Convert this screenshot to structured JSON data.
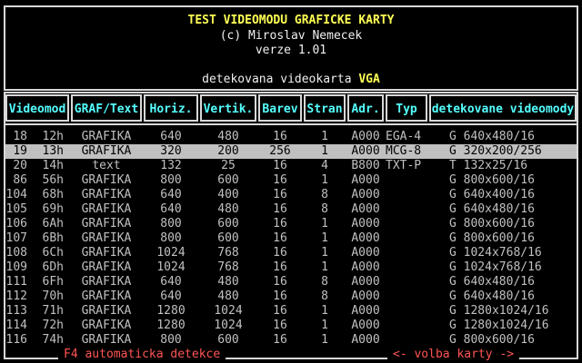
{
  "header": {
    "title": "TEST VIDEOMODU GRAFICKE KARTY",
    "author": "(c) Miroslav Nemecek",
    "version": "verze 1.01",
    "detected_label": "detekovana videokarta",
    "detected_card": "VGA"
  },
  "columns": [
    "Videomod",
    "GRAF/Text",
    "Horiz.",
    "Vertik.",
    "Barev",
    "Stran",
    "Adr.",
    "Typ",
    "detekovane videomody"
  ],
  "rows": [
    {
      "dec": "18",
      "hex": "12h",
      "mode": "GRAFIKA",
      "h": "640",
      "v": "480",
      "colors": "16",
      "pages": "1",
      "addr": "A000",
      "type": "EGA-4",
      "det": "G 640x480/16"
    },
    {
      "dec": "19",
      "hex": "13h",
      "mode": "GRAFIKA",
      "h": "320",
      "v": "200",
      "colors": "256",
      "pages": "1",
      "addr": "A000",
      "type": "MCG-8",
      "det": "G 320x200/256"
    },
    {
      "dec": "20",
      "hex": "14h",
      "mode": "text",
      "h": "132",
      "v": "25",
      "colors": "16",
      "pages": "4",
      "addr": "B800",
      "type": "TXT-P",
      "det": "T 132x25/16"
    },
    {
      "dec": "86",
      "hex": "56h",
      "mode": "GRAFIKA",
      "h": "800",
      "v": "600",
      "colors": "16",
      "pages": "1",
      "addr": "A000",
      "type": "",
      "det": "G 800x600/16"
    },
    {
      "dec": "104",
      "hex": "68h",
      "mode": "GRAFIKA",
      "h": "640",
      "v": "400",
      "colors": "16",
      "pages": "8",
      "addr": "A000",
      "type": "",
      "det": "G 640x400/16"
    },
    {
      "dec": "105",
      "hex": "69h",
      "mode": "GRAFIKA",
      "h": "640",
      "v": "480",
      "colors": "16",
      "pages": "8",
      "addr": "A000",
      "type": "",
      "det": "G 640x480/16"
    },
    {
      "dec": "106",
      "hex": "6Ah",
      "mode": "GRAFIKA",
      "h": "800",
      "v": "600",
      "colors": "16",
      "pages": "1",
      "addr": "A000",
      "type": "",
      "det": "G 800x600/16"
    },
    {
      "dec": "107",
      "hex": "6Bh",
      "mode": "GRAFIKA",
      "h": "800",
      "v": "600",
      "colors": "16",
      "pages": "1",
      "addr": "A000",
      "type": "",
      "det": "G 800x600/16"
    },
    {
      "dec": "108",
      "hex": "6Ch",
      "mode": "GRAFIKA",
      "h": "1024",
      "v": "768",
      "colors": "16",
      "pages": "1",
      "addr": "A000",
      "type": "",
      "det": "G 1024x768/16"
    },
    {
      "dec": "109",
      "hex": "6Dh",
      "mode": "GRAFIKA",
      "h": "1024",
      "v": "768",
      "colors": "16",
      "pages": "1",
      "addr": "A000",
      "type": "",
      "det": "G 1024x768/16"
    },
    {
      "dec": "111",
      "hex": "6Fh",
      "mode": "GRAFIKA",
      "h": "640",
      "v": "480",
      "colors": "16",
      "pages": "8",
      "addr": "A000",
      "type": "",
      "det": "G 640x480/16"
    },
    {
      "dec": "112",
      "hex": "70h",
      "mode": "GRAFIKA",
      "h": "640",
      "v": "480",
      "colors": "16",
      "pages": "8",
      "addr": "A000",
      "type": "",
      "det": "G 640x480/16"
    },
    {
      "dec": "113",
      "hex": "71h",
      "mode": "GRAFIKA",
      "h": "1280",
      "v": "1024",
      "colors": "16",
      "pages": "1",
      "addr": "A000",
      "type": "",
      "det": "G 1280x1024/16"
    },
    {
      "dec": "114",
      "hex": "72h",
      "mode": "GRAFIKA",
      "h": "1280",
      "v": "1024",
      "colors": "16",
      "pages": "1",
      "addr": "A000",
      "type": "",
      "det": "G 1280x1024/16"
    },
    {
      "dec": "116",
      "hex": "74h",
      "mode": "GRAFIKA",
      "h": "800",
      "v": "600",
      "colors": "16",
      "pages": "1",
      "addr": "A000",
      "type": "",
      "det": "G 800x600/16"
    }
  ],
  "selected_row": 1,
  "footer": {
    "left": "F4 automaticka detekce",
    "right": "<- volba karty ->"
  },
  "colors": {
    "title": "#ffff55",
    "column_header": "#55ffff",
    "footer": "#ff5555",
    "selection": "#c0c0c0"
  }
}
